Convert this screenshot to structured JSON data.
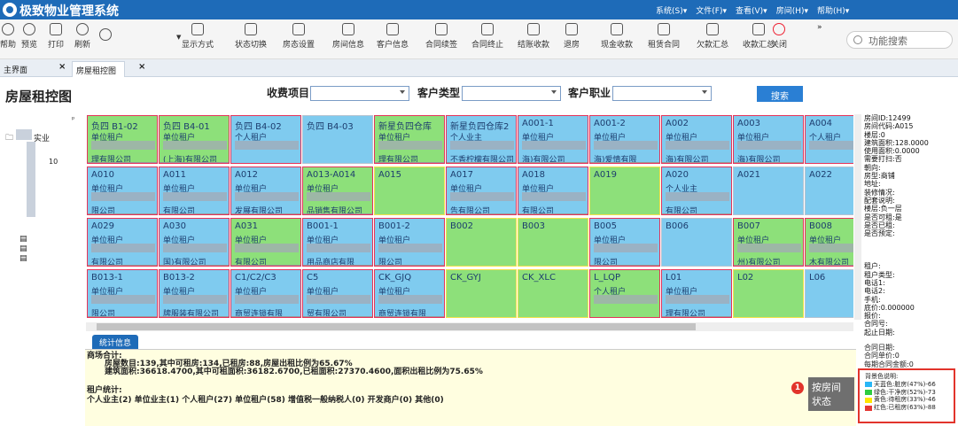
{
  "app": {
    "title": "极致物业管理系统",
    "menus": [
      "系统(S)▾",
      "文件(F)▾",
      "查看(V)▾",
      "房间(H)▾",
      "帮助(H)▾"
    ]
  },
  "toolbar": {
    "left": [
      "帮助",
      "预览",
      "打印",
      "刷新"
    ],
    "items": [
      "显示方式",
      "状态切换",
      "房态设置",
      "房间信息",
      "客户信息",
      "合同续签",
      "合同终止",
      "结账收款",
      "退房",
      "现金收款",
      "租赁合同",
      "欠款汇总",
      "收款汇总",
      "关闭"
    ],
    "more": "»",
    "search_placeholder": "功能搜索"
  },
  "tabs": [
    {
      "label": "主界面"
    },
    {
      "label": "房屋租控图"
    }
  ],
  "filters": {
    "page_title": "房屋租控图",
    "fee_label": "收费项目",
    "cust_type_label": "客户类型",
    "cust_job_label": "客户职业",
    "search_button": "搜索"
  },
  "tree": {
    "root": "实业",
    "child": "10"
  },
  "grid": {
    "rows": [
      [
        {
          "code": "负四 B1-02",
          "type": "单位租户",
          "company": "理有限公司",
          "color": "green",
          "border": "red"
        },
        {
          "code": "负四 B4-01",
          "type": "单位租户",
          "company": "(上海)有限公司",
          "color": "green",
          "border": "red"
        },
        {
          "code": "负四 B4-02",
          "type": "个人租户",
          "company": "",
          "color": "blue",
          "border": "red"
        },
        {
          "code": "负四 B4-03",
          "type": "",
          "company": "",
          "color": "blue",
          "border": "grey"
        },
        {
          "code": "新星负四仓库",
          "type": "单位租户",
          "company": "理有限公司",
          "color": "green",
          "border": "red"
        },
        {
          "code": "新星负四仓库2",
          "type": "个人业主",
          "company": "不香柠檬有限公司",
          "color": "blue",
          "border": "red"
        },
        {
          "code": "A001-1",
          "type": "单位租户",
          "company": "海)有限公司",
          "color": "blue",
          "border": "red"
        },
        {
          "code": "A001-2",
          "type": "单位租户",
          "company": "海)爱情有限",
          "color": "blue",
          "border": "red"
        },
        {
          "code": "A002",
          "type": "单位租户",
          "company": "海)有限公司",
          "color": "blue",
          "border": "red"
        },
        {
          "code": "A003",
          "type": "单位租户",
          "company": "海)有限公司",
          "color": "blue",
          "border": "red"
        },
        {
          "code": "A004",
          "type": "个人租户",
          "company": "",
          "color": "blue",
          "border": "red"
        }
      ],
      [
        {
          "code": "A010",
          "type": "单位租户",
          "company": "限公司",
          "color": "blue",
          "border": "red"
        },
        {
          "code": "A011",
          "type": "单位租户",
          "company": "有限公司",
          "color": "blue",
          "border": "red"
        },
        {
          "code": "A012",
          "type": "单位租户",
          "company": "发展有限公司",
          "color": "blue",
          "border": "red"
        },
        {
          "code": "A013-A014",
          "type": "单位租户",
          "company": "品销售有限公司",
          "color": "green",
          "border": "red"
        },
        {
          "code": "A015",
          "type": "",
          "company": "",
          "color": "green",
          "border": "yellow"
        },
        {
          "code": "A017",
          "type": "单位租户",
          "company": "告有限公司",
          "color": "blue",
          "border": "red"
        },
        {
          "code": "A018",
          "type": "单位租户",
          "company": "有限公司",
          "color": "blue",
          "border": "red"
        },
        {
          "code": "A019",
          "type": "",
          "company": "",
          "color": "green",
          "border": "yellow"
        },
        {
          "code": "A020",
          "type": "个人业主",
          "company": "有限公司",
          "color": "blue",
          "border": "red"
        },
        {
          "code": "A021",
          "type": "",
          "company": "",
          "color": "blue",
          "border": "grey"
        },
        {
          "code": "A022",
          "type": "",
          "company": "",
          "color": "blue",
          "border": "grey"
        }
      ],
      [
        {
          "code": "A029",
          "type": "单位租户",
          "company": "有限公司",
          "color": "blue",
          "border": "red"
        },
        {
          "code": "A030",
          "type": "单位租户",
          "company": "国)有限公司",
          "color": "blue",
          "border": "red"
        },
        {
          "code": "A031",
          "type": "单位租户",
          "company": "有限公司",
          "color": "green",
          "border": "red"
        },
        {
          "code": "B001-1",
          "type": "单位租户",
          "company": "用品商店有限",
          "color": "blue",
          "border": "red"
        },
        {
          "code": "B001-2",
          "type": "单位租户",
          "company": "限公司",
          "color": "blue",
          "border": "red"
        },
        {
          "code": "B002",
          "type": "",
          "company": "",
          "color": "green",
          "border": "yellow"
        },
        {
          "code": "B003",
          "type": "",
          "company": "",
          "color": "green",
          "border": "yellow"
        },
        {
          "code": "B005",
          "type": "单位租户",
          "company": "限公司",
          "color": "blue",
          "border": "red"
        },
        {
          "code": "B006",
          "type": "",
          "company": "",
          "color": "blue",
          "border": "grey"
        },
        {
          "code": "B007",
          "type": "单位租户",
          "company": "州)有限公司",
          "color": "green",
          "border": "red"
        },
        {
          "code": "B008",
          "type": "单位租户",
          "company": "木有限公司",
          "color": "green",
          "border": "red"
        }
      ],
      [
        {
          "code": "B013-1",
          "type": "单位租户",
          "company": "限公司",
          "color": "blue",
          "border": "red"
        },
        {
          "code": "B013-2",
          "type": "单位租户",
          "company": "牌服装有限公司",
          "color": "blue",
          "border": "red"
        },
        {
          "code": "C1/C2/C3",
          "type": "单位租户",
          "company": "商贸连锁有限",
          "color": "blue",
          "border": "red"
        },
        {
          "code": "C5",
          "type": "单位租户",
          "company": "贸有限公司",
          "color": "blue",
          "border": "red"
        },
        {
          "code": "CK_GJQ",
          "type": "单位租户",
          "company": "商贸连锁有限",
          "color": "blue",
          "border": "red"
        },
        {
          "code": "CK_GYJ",
          "type": "",
          "company": "",
          "color": "green",
          "border": "yellow"
        },
        {
          "code": "CK_XLC",
          "type": "",
          "company": "",
          "color": "green",
          "border": "yellow"
        },
        {
          "code": "L_LQP",
          "type": "个人租户",
          "company": "",
          "color": "green",
          "border": "red"
        },
        {
          "code": "L01",
          "type": "单位租户",
          "company": "理有限公司",
          "color": "blue",
          "border": "red"
        },
        {
          "code": "L02",
          "type": "",
          "company": "",
          "color": "green",
          "border": "yellow"
        },
        {
          "code": "L06",
          "type": "",
          "company": "",
          "color": "blue",
          "border": "grey"
        }
      ]
    ]
  },
  "info_panel": {
    "lines": [
      "房间ID:12499",
      "房间代码:A015",
      "楼层:0",
      "建筑面积:128.0000",
      "使用面积:0.0000",
      "需要打扫:否",
      "朝向:",
      "房型:商铺",
      "地址:",
      "装修情况:",
      "配套说明:",
      "楼层:负一层",
      "是否可租:是",
      "是否已租:",
      "是否预定:",
      "",
      "",
      "",
      "租户:",
      "租户类型:",
      "电话1:",
      "电话2:",
      "手机:",
      "底价:0.000000",
      "报价:",
      "合同号:",
      "起止日期:"
    ],
    "lines2": [
      "合同日期:",
      "合同单价:0",
      "每期合同金额:0"
    ],
    "legend_title": "背景色说明:",
    "legend": [
      {
        "label": "天蓝色:脏房(47%)-66",
        "color": "#29b6f6"
      },
      {
        "label": "绿色:干净房(52%)-73",
        "color": "#2ecc40"
      },
      {
        "label": "黄色:待租房(33%)-46",
        "color": "#ffe600"
      },
      {
        "label": "红色:已租房(63%)-88",
        "color": "#e53935"
      }
    ]
  },
  "stats": {
    "tab_label": "统计信息",
    "mall_title": "商场合计:",
    "line1": "房屋数目:139,其中可租房:134,已租房:88,房屋出租比例为65.67%",
    "line2": "建筑面积:36618.4700,其中可租面积:36182.6700,已租面积:27370.4600,面积出租比例为75.65%",
    "tenant_title": "租户统计:",
    "tenant_line": "个人业主(2) 单位业主(1) 个人租户(27) 单位租户(58) 增值税一般纳税人(0) 开发商户(0) 其他(0)"
  },
  "callout": {
    "badge": "1",
    "line1": "按房间",
    "line2": "状态"
  }
}
